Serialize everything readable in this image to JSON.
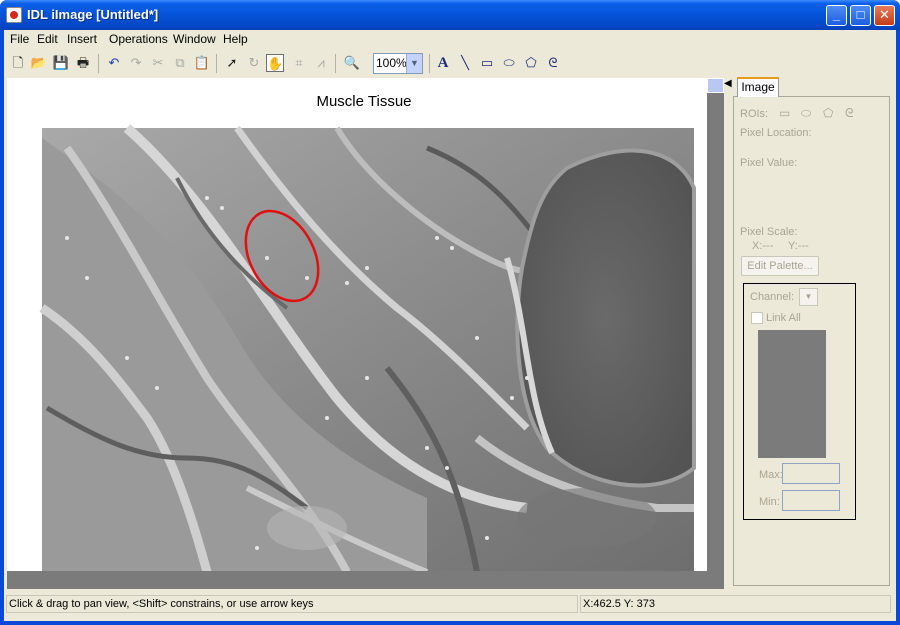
{
  "window": {
    "title": "IDL iImage [Untitled*]",
    "minimize": "_",
    "maximize": "□",
    "close": "✕"
  },
  "menu": [
    "File",
    "Edit",
    "Insert",
    "Operations",
    "Window",
    "Help"
  ],
  "toolbar": {
    "zoom_value": "100%",
    "icons": [
      "new-file",
      "open-folder",
      "save",
      "print",
      "undo",
      "redo",
      "cut",
      "copy",
      "paste",
      "select-arrow",
      "rotate",
      "pan-hand",
      "crop",
      "line-profile",
      "zoom-magnifier",
      "text-tool",
      "line-tool",
      "rectangle-tool",
      "ellipse-tool",
      "polygon-tool",
      "freehand-tool"
    ]
  },
  "canvas": {
    "title": "Muscle Tissue",
    "roi_color": "#e01010"
  },
  "panel": {
    "tab": "Image",
    "rois_label": "ROIs:",
    "pixel_location_label": "Pixel Location:",
    "pixel_value_label": "Pixel Value:",
    "pixel_scale_label": "Pixel Scale:",
    "x_label": "X:---",
    "y_label": "Y:---",
    "edit_palette": "Edit Palette...",
    "channel_label": "Channel:",
    "link_all": "Link All",
    "max_label": "Max:",
    "min_label": "Min:"
  },
  "status": {
    "hint": "Click & drag to pan view, <Shift> constrains, or use arrow keys",
    "coords": "X:462.5  Y: 373"
  }
}
